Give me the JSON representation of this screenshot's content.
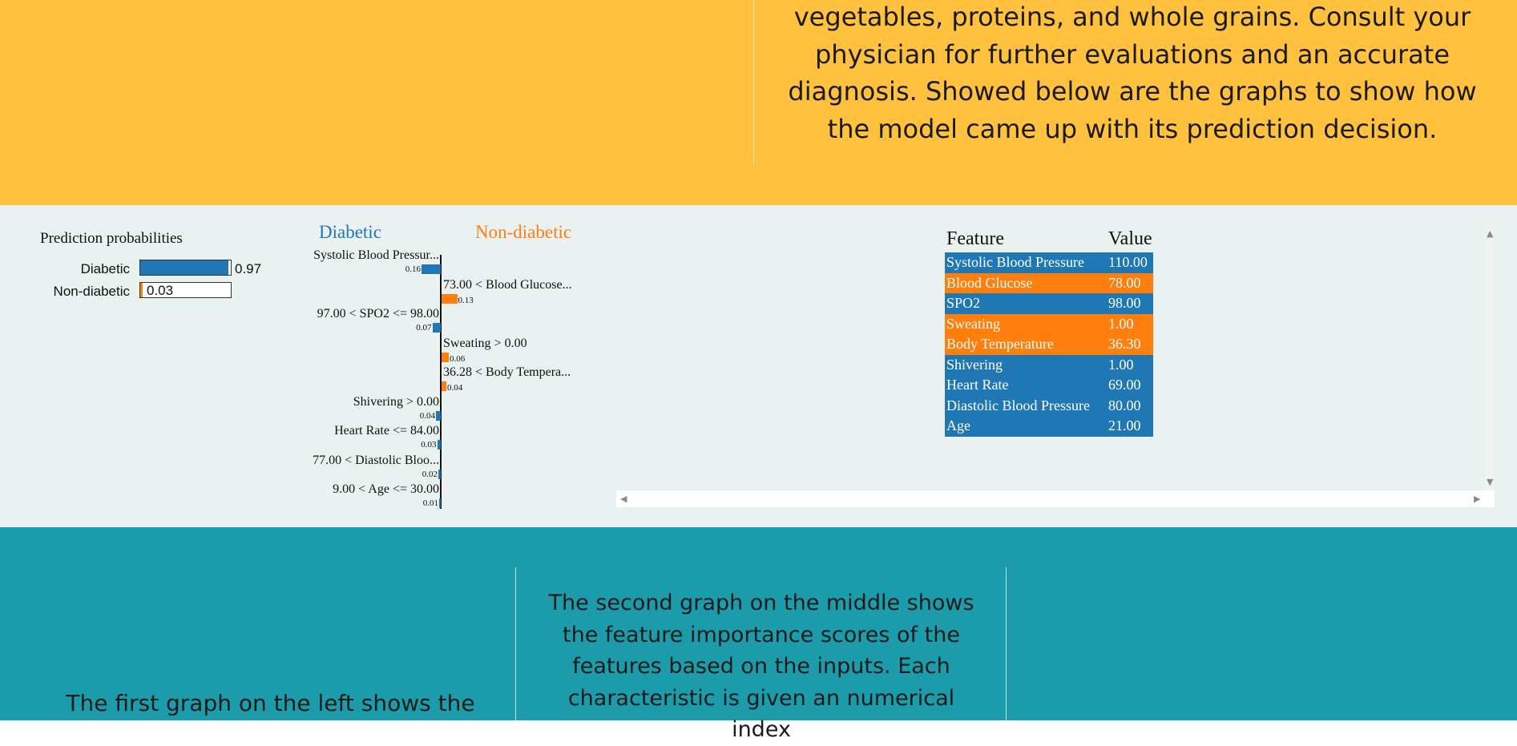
{
  "top_text": "vegetables, proteins, and whole grains. Consult your physician for further evaluations and an accurate diagnosis. Showed below are the graphs to show how the model came up with its prediction decision.",
  "colors": {
    "blue": "#1f77b4",
    "orange": "#ff7f0e",
    "top_bg": "#ffc13e",
    "bottom_bg": "#1c9caa",
    "mid_bg": "#e9f1f1"
  },
  "prediction": {
    "title": "Prediction probabilities",
    "rows": [
      {
        "label": "Diabetic",
        "value": "0.97",
        "prob": 0.97,
        "color": "#1f77b4"
      },
      {
        "label": "Non-diabetic",
        "value": "0.03",
        "prob": 0.03,
        "color": "#ff7f0e"
      }
    ]
  },
  "importance": {
    "left_title": "Diabetic",
    "right_title": "Non-diabetic",
    "features": [
      {
        "label": "Systolic Blood Pressur...",
        "value": "0.16",
        "weight": 0.16,
        "side": "left"
      },
      {
        "label": "73.00 < Blood Glucose...",
        "value": "0.13",
        "weight": 0.13,
        "side": "right"
      },
      {
        "label": "97.00 < SPO2 <= 98.00",
        "value": "0.07",
        "weight": 0.07,
        "side": "left"
      },
      {
        "label": "Sweating > 0.00",
        "value": "0.06",
        "weight": 0.06,
        "side": "right"
      },
      {
        "label": "36.28 < Body Tempera...",
        "value": "0.04",
        "weight": 0.04,
        "side": "right"
      },
      {
        "label": "Shivering > 0.00",
        "value": "0.04",
        "weight": 0.04,
        "side": "left"
      },
      {
        "label": "Heart Rate <= 84.00",
        "value": "0.03",
        "weight": 0.03,
        "side": "left"
      },
      {
        "label": "77.00 < Diastolic Bloo...",
        "value": "0.02",
        "weight": 0.02,
        "side": "left"
      },
      {
        "label": "9.00 < Age <= 30.00",
        "value": "0.01",
        "weight": 0.01,
        "side": "left"
      }
    ]
  },
  "table": {
    "headers": [
      "Feature",
      "Value"
    ],
    "rows": [
      {
        "feature": "Systolic Blood Pressure",
        "value": "110.00",
        "color": "blue"
      },
      {
        "feature": "Blood Glucose",
        "value": "78.00",
        "color": "orange"
      },
      {
        "feature": "SPO2",
        "value": "98.00",
        "color": "blue"
      },
      {
        "feature": "Sweating",
        "value": "1.00",
        "color": "orange"
      },
      {
        "feature": "Body Temperature",
        "value": "36.30",
        "color": "orange"
      },
      {
        "feature": "Shivering",
        "value": "1.00",
        "color": "blue"
      },
      {
        "feature": "Heart Rate",
        "value": "69.00",
        "color": "blue"
      },
      {
        "feature": "Diastolic Blood Pressure",
        "value": "80.00",
        "color": "blue"
      },
      {
        "feature": "Age",
        "value": "21.00",
        "color": "blue"
      }
    ]
  },
  "bottom": {
    "left_text": "The first graph on the left shows the",
    "middle_text": "The second graph on the middle shows the feature importance scores of the features based on the inputs. Each characteristic is given an numerical index"
  }
}
